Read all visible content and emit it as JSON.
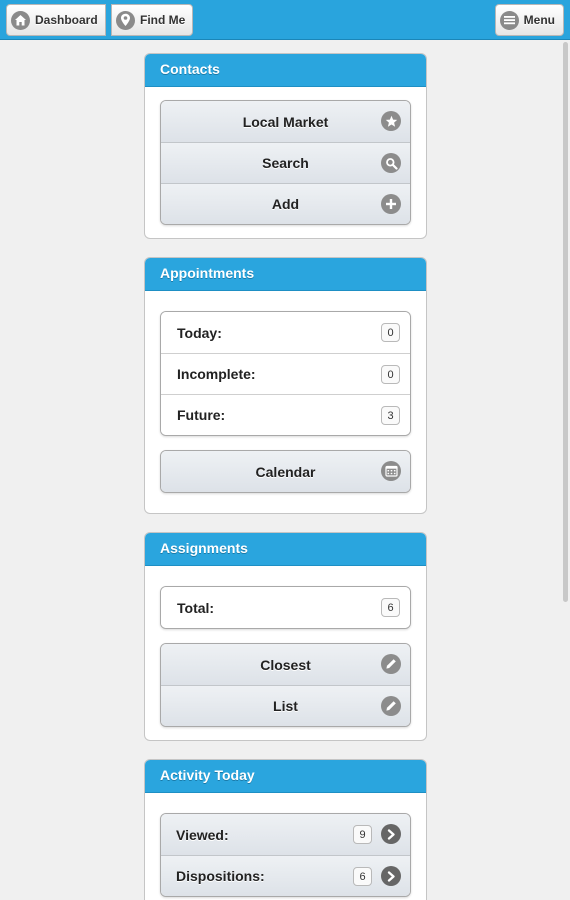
{
  "topbar": {
    "dashboard_label": "Dashboard",
    "findme_label": "Find Me",
    "menu_label": "Menu",
    "dashboard_icon": "home-icon",
    "findme_icon": "location-pin-icon",
    "menu_icon": "hamburger-icon"
  },
  "contacts": {
    "title": "Contacts",
    "buttons": [
      {
        "label": "Local Market",
        "icon": "star-icon"
      },
      {
        "label": "Search",
        "icon": "search-icon"
      },
      {
        "label": "Add",
        "icon": "plus-icon"
      }
    ]
  },
  "appointments": {
    "title": "Appointments",
    "rows": [
      {
        "label": "Today:",
        "count": "0"
      },
      {
        "label": "Incomplete:",
        "count": "0"
      },
      {
        "label": "Future:",
        "count": "3"
      }
    ],
    "calendar_label": "Calendar",
    "calendar_icon": "calendar-icon"
  },
  "assignments": {
    "title": "Assignments",
    "total_label": "Total:",
    "total_count": "6",
    "buttons": [
      {
        "label": "Closest",
        "icon": "pencil-icon"
      },
      {
        "label": "List",
        "icon": "pencil-icon"
      }
    ]
  },
  "activity": {
    "title": "Activity Today",
    "rows": [
      {
        "label": "Viewed:",
        "count": "9",
        "icon": "arrow-right-icon"
      },
      {
        "label": "Dispositions:",
        "count": "6",
        "icon": "arrow-right-icon"
      }
    ]
  },
  "colors": {
    "accent": "#2aa5de",
    "icon_gray": "#8c8c8c",
    "background": "#f0f0f0"
  }
}
